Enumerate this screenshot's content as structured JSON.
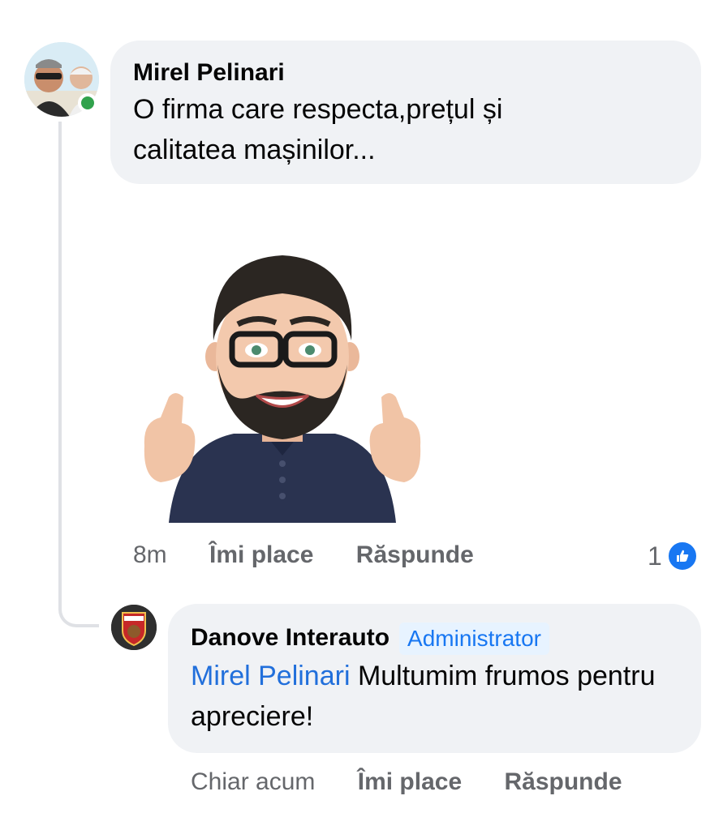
{
  "comment": {
    "author": "Mirel Pelinari",
    "text": "O firma care respecta,prețul și calitatea mașinilor...",
    "sticker": "bearded-man-thumbs-up-sticker",
    "time": "8m",
    "like_label": "Îmi place",
    "reply_label": "Răspunde",
    "reaction_count": "1",
    "reaction_icon": "like-icon"
  },
  "reply": {
    "author": "Danove Interauto",
    "badge": "Administrator",
    "mention": "Mirel Pelinari",
    "text": " Multumim frumos pentru apreciere!",
    "time": "Chiar acum",
    "like_label": "Îmi place",
    "reply_label": "Răspunde"
  },
  "colors": {
    "bubble": "#f0f2f5",
    "link": "#216fdb",
    "meta": "#65676b",
    "online": "#31a24c",
    "like": "#1877f2"
  }
}
